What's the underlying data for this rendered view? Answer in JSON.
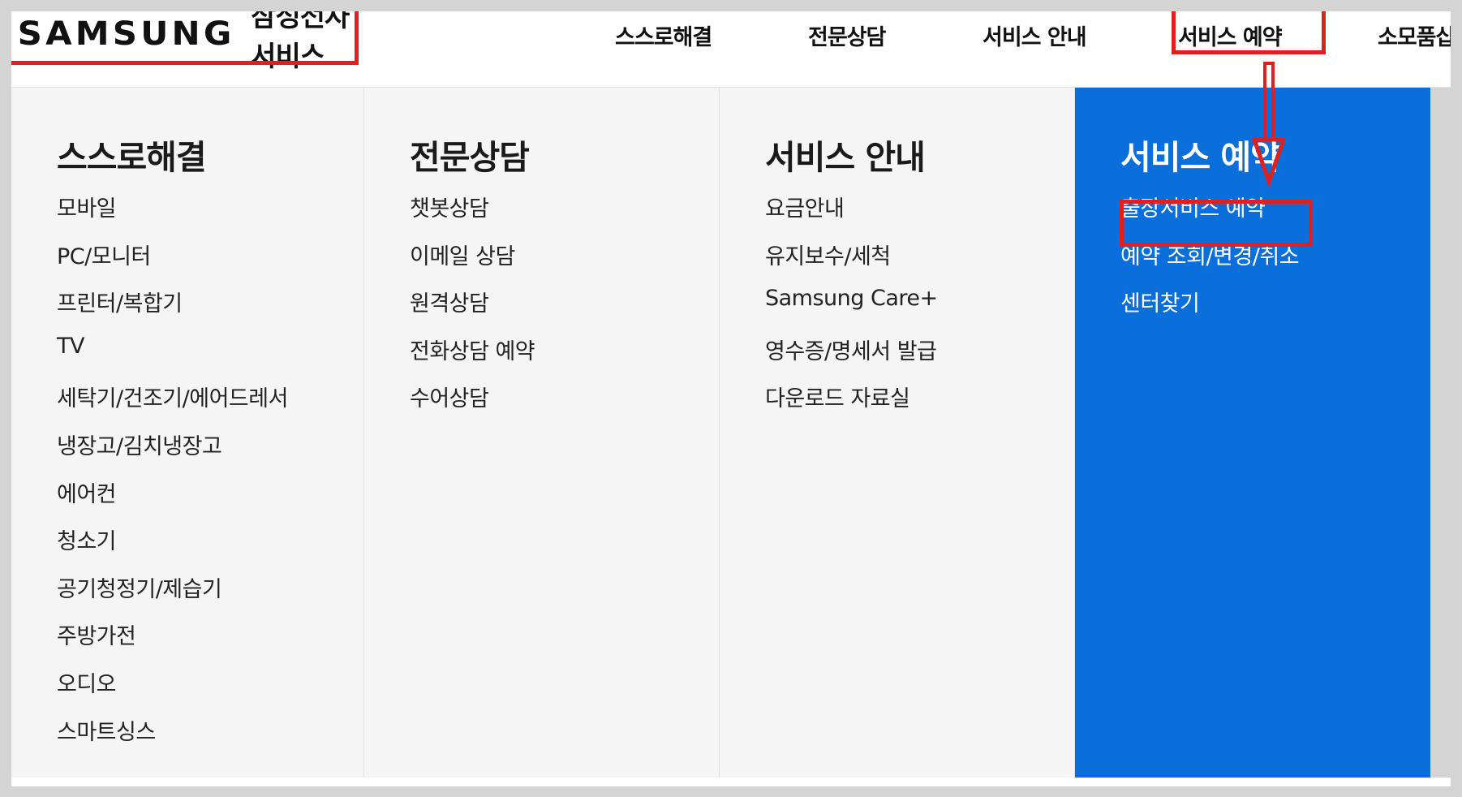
{
  "header": {
    "logo": "SAMSUNG",
    "brand_sub": "삼성전자서비스",
    "nav": [
      "스스로해결",
      "전문상담",
      "서비스 안내",
      "서비스 예약",
      "소모품샵"
    ]
  },
  "menu": {
    "columns": [
      {
        "title": "스스로해결",
        "items": [
          "모바일",
          "PC/모니터",
          "프린터/복합기",
          "TV",
          "세탁기/건조기/에어드레서",
          "냉장고/김치냉장고",
          "에어컨",
          "청소기",
          "공기청정기/제습기",
          "주방가전",
          "오디오",
          "스마트싱스"
        ]
      },
      {
        "title": "전문상담",
        "items": [
          "챗봇상담",
          "이메일 상담",
          "원격상담",
          "전화상담 예약",
          "수어상담"
        ]
      },
      {
        "title": "서비스 안내",
        "items": [
          "요금안내",
          "유지보수/세척",
          "Samsung Care+",
          "영수증/명세서 발급",
          "다운로드 자료실"
        ]
      },
      {
        "title": "서비스 예약",
        "items": [
          "출장서비스 예약",
          "예약 조회/변경/취소",
          "센터찾기"
        ]
      }
    ]
  },
  "colors": {
    "active_bg": "#0b6fdb",
    "highlight": "#e02020"
  }
}
